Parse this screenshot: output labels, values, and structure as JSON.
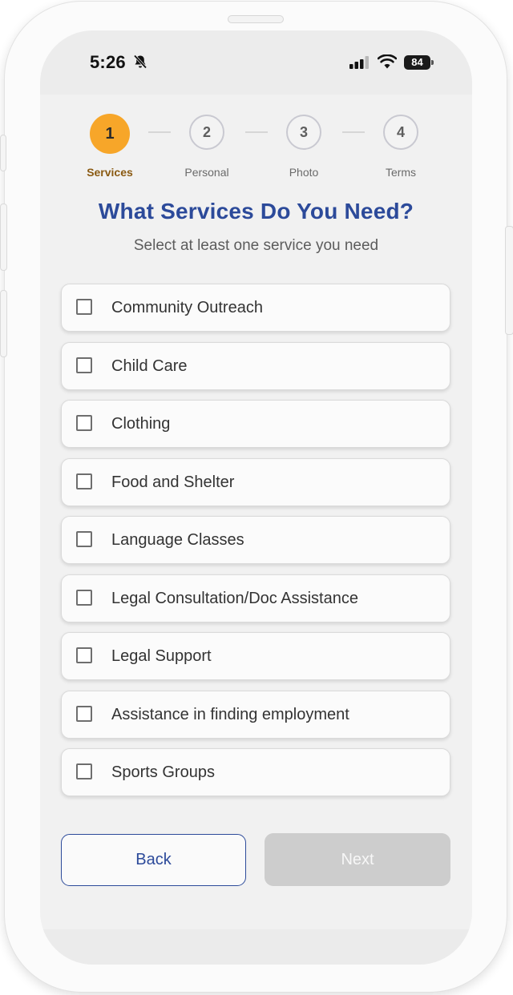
{
  "status_bar": {
    "time": "5:26",
    "battery": "84",
    "icons": [
      "bell-off-icon",
      "cellular-signal-icon",
      "wifi-icon",
      "battery-icon"
    ]
  },
  "stepper": {
    "steps": [
      {
        "number": "1",
        "label": "Services",
        "active": true
      },
      {
        "number": "2",
        "label": "Personal",
        "active": false
      },
      {
        "number": "3",
        "label": "Photo",
        "active": false
      },
      {
        "number": "4",
        "label": "Terms",
        "active": false
      }
    ]
  },
  "page": {
    "title": "What Services Do You Need?",
    "subtitle": "Select at least one service you need"
  },
  "services": [
    {
      "label": "Community Outreach",
      "checked": false
    },
    {
      "label": "Child Care",
      "checked": false
    },
    {
      "label": "Clothing",
      "checked": false
    },
    {
      "label": "Food and Shelter",
      "checked": false
    },
    {
      "label": "Language Classes",
      "checked": false
    },
    {
      "label": "Legal Consultation/Doc Assistance",
      "checked": false
    },
    {
      "label": "Legal Support",
      "checked": false
    },
    {
      "label": "Assistance in finding employment",
      "checked": false
    },
    {
      "label": "Sports Groups",
      "checked": false
    }
  ],
  "buttons": {
    "back": "Back",
    "next": "Next"
  },
  "colors": {
    "accent": "#f7a629",
    "primary": "#2c4a9a",
    "disabled": "#cdcdcd"
  }
}
